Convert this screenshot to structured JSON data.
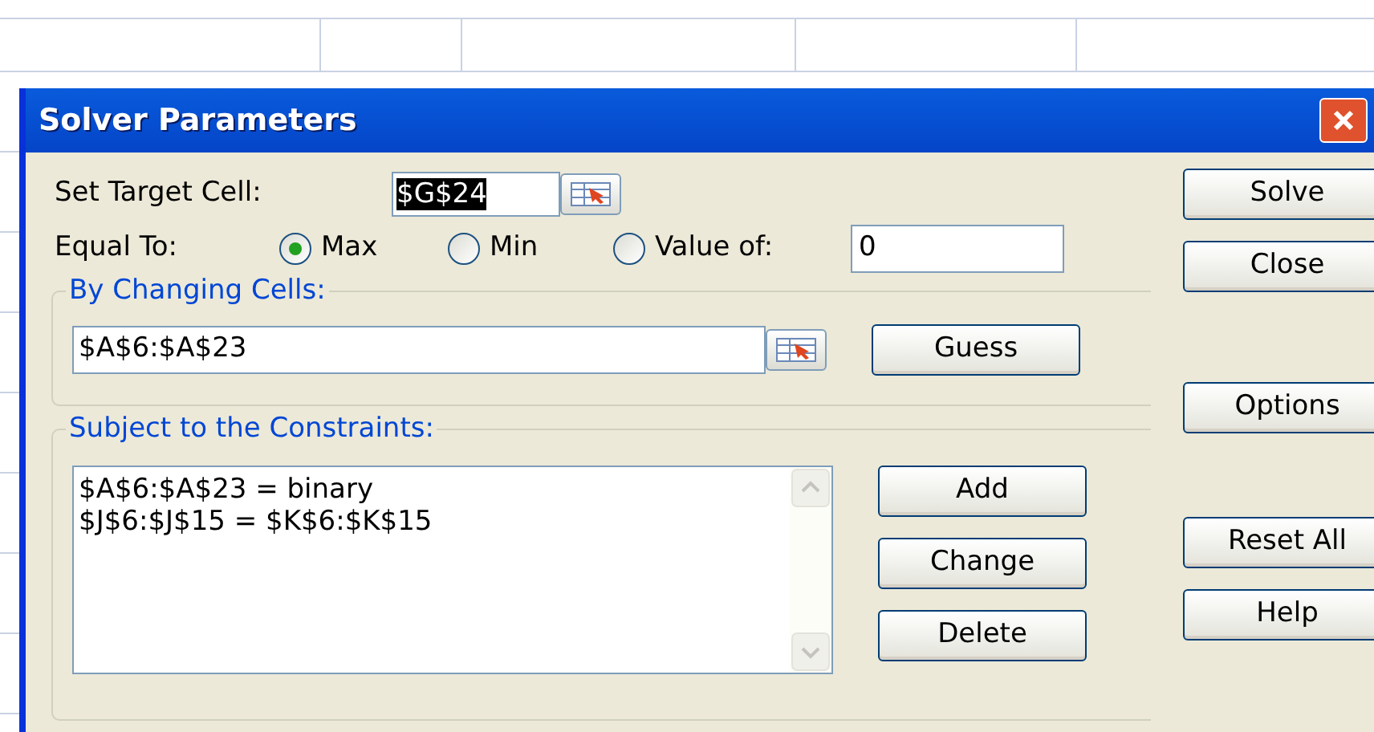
{
  "window": {
    "title": "Solver Parameters"
  },
  "target_cell": {
    "label": "Set Target Cell:",
    "value": "$G$24"
  },
  "equal_to": {
    "label": "Equal To:",
    "options": [
      {
        "label": "Max",
        "selected": true
      },
      {
        "label": "Min",
        "selected": false
      },
      {
        "label": "Value of:",
        "selected": false
      }
    ],
    "value_field": "0"
  },
  "changing_cells": {
    "label": "By Changing Cells:",
    "value": "$A$6:$A$23",
    "button": "Guess"
  },
  "constraints": {
    "label": "Subject to the Constraints:",
    "items": [
      "$A$6:$A$23 = binary",
      "$J$6:$J$15 = $K$6:$K$15"
    ],
    "buttons": [
      "Add",
      "Change",
      "Delete"
    ]
  },
  "side_buttons": {
    "top": [
      "Solve",
      "Close"
    ],
    "middle": [
      "Options"
    ],
    "bottom": [
      "Reset All",
      "Help"
    ]
  }
}
